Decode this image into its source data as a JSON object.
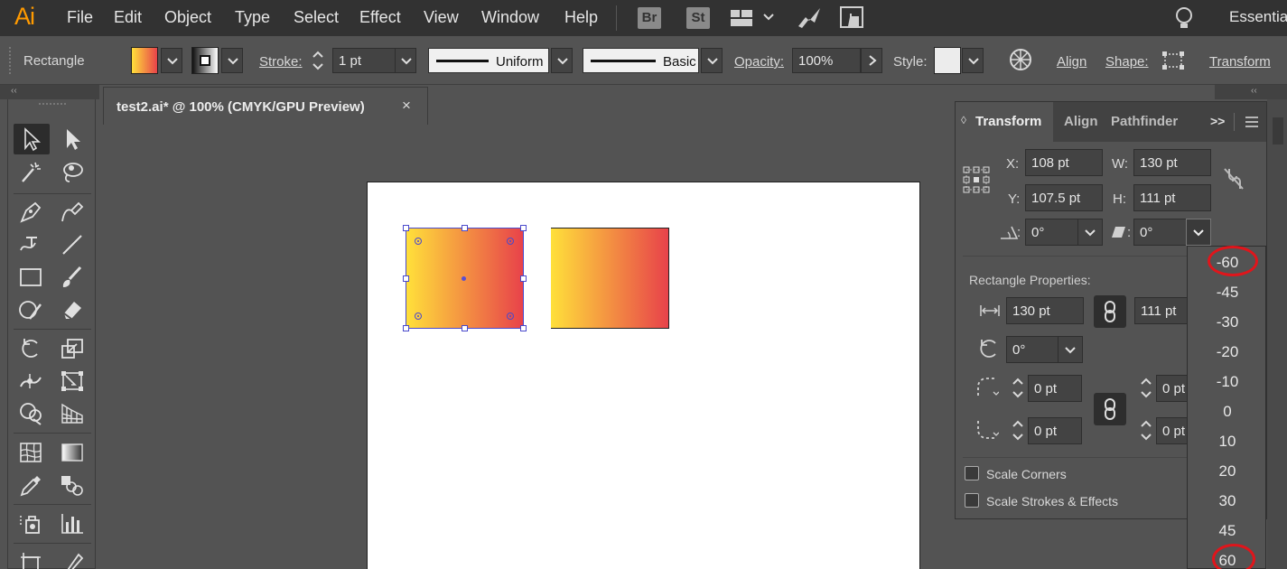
{
  "app": {
    "logo": "Ai",
    "menu": [
      "File",
      "Edit",
      "Object",
      "Type",
      "Select",
      "Effect",
      "View",
      "Window",
      "Help"
    ],
    "bridge_labels": [
      "Br",
      "St"
    ],
    "workspace": "Essentia",
    "accent_color": "#ff9a00"
  },
  "control_bar": {
    "selection_label": "Rectangle",
    "stroke_label": "Stroke:",
    "stroke_weight": "1 pt",
    "stroke_profile": "Uniform",
    "brush_label": "Basic",
    "opacity_label": "Opacity:",
    "opacity_value": "100%",
    "style_label": "Style:",
    "align_link": "Align",
    "shape_link": "Shape:",
    "transform_link": "Transform"
  },
  "document": {
    "tab_title": "test2.ai* @ 100% (CMYK/GPU Preview)",
    "close_glyph": "×",
    "gradient_start": "#ffe03a",
    "gradient_end": "#e8424a"
  },
  "panel": {
    "tabs": [
      "Transform",
      "Align",
      "Pathfinder"
    ],
    "more_glyph": ">>",
    "x_label": "X:",
    "x_value": "108 pt",
    "y_label": "Y:",
    "y_value": "107.5 pt",
    "w_label": "W:",
    "w_value": "130 pt",
    "h_label": "H:",
    "h_value": "111 pt",
    "rotate_value": "0°",
    "shear_value": "0°",
    "props_heading": "Rectangle Properties:",
    "rect_width": "130 pt",
    "rect_height": "111 pt",
    "rect_rotation": "0°",
    "corner_tl": "0 pt",
    "corner_tr": "0 pt",
    "corner_bl": "0 pt",
    "corner_br": "0 pt",
    "scale_corners": "Scale Corners",
    "scale_strokes": "Scale Strokes & Effects"
  },
  "angle_dropdown": {
    "options": [
      "-60",
      "-45",
      "-30",
      "-20",
      "-10",
      "0",
      "10",
      "20",
      "30",
      "45",
      "60"
    ],
    "highlight_color": "#e0151b"
  }
}
